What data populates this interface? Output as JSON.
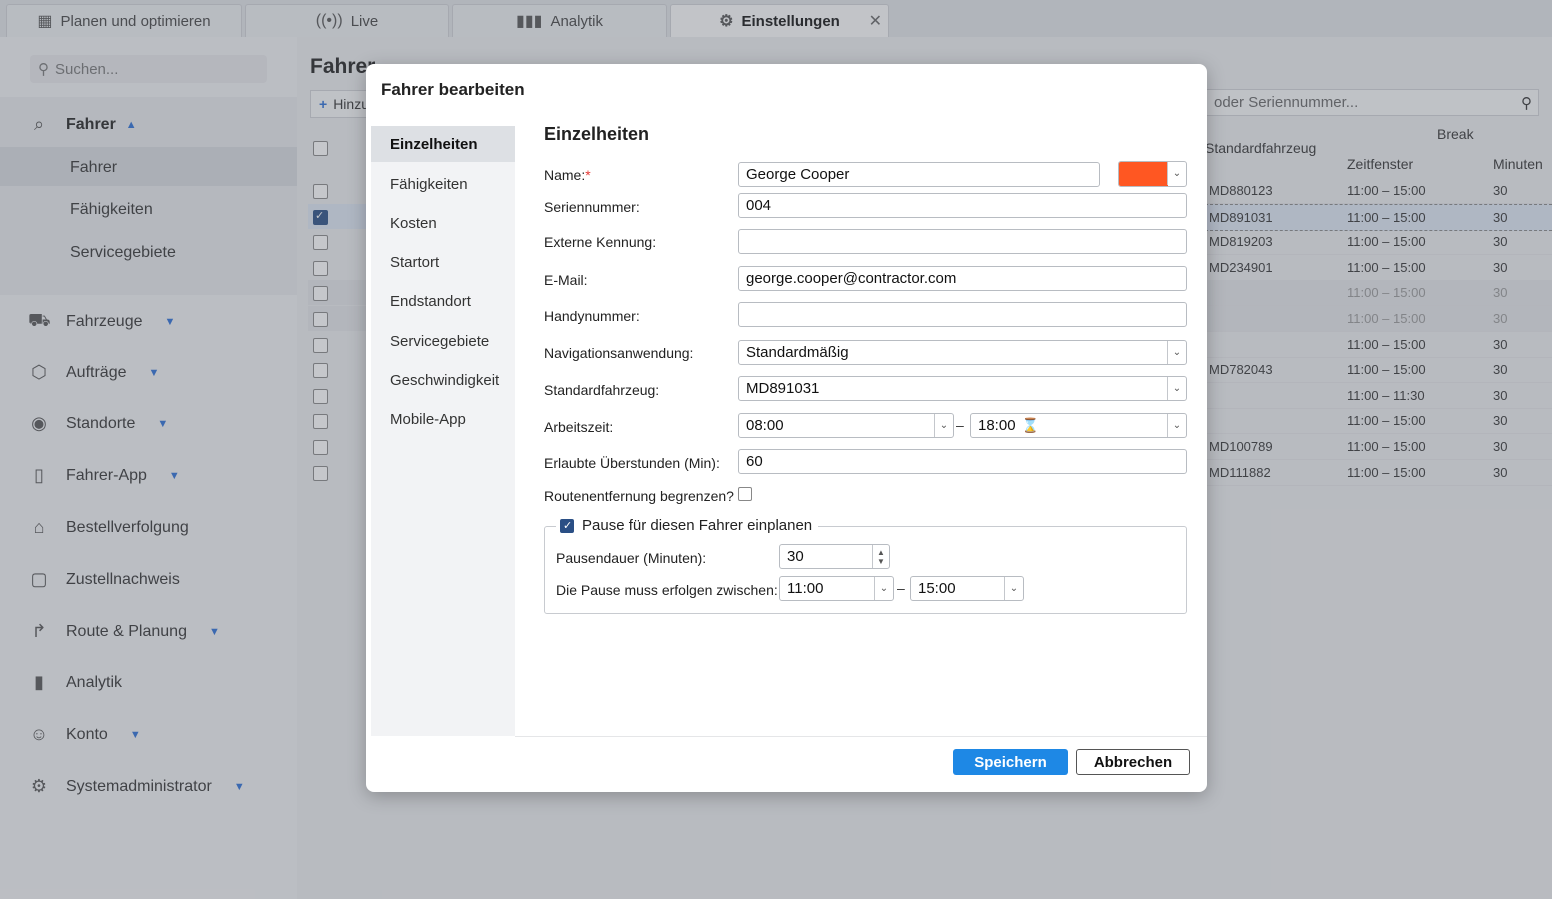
{
  "tabs": [
    {
      "label": "Planen und optimieren",
      "icon": "calendar-icon"
    },
    {
      "label": "Live",
      "icon": "broadcast-icon"
    },
    {
      "label": "Analytik",
      "icon": "bar-chart-icon"
    },
    {
      "label": "Einstellungen",
      "icon": "gear-icon",
      "active": true
    }
  ],
  "sidebar": {
    "search_placeholder": "Suchen...",
    "group": {
      "label": "Fahrer",
      "sub": [
        "Fahrer",
        "Fähigkeiten",
        "Servicegebiete"
      ]
    },
    "items": [
      {
        "label": "Fahrzeuge",
        "icon": "truck-icon",
        "has_caret": true
      },
      {
        "label": "Aufträge",
        "icon": "box-icon",
        "has_caret": true
      },
      {
        "label": "Standorte",
        "icon": "location-pin-icon",
        "has_caret": true
      },
      {
        "label": "Fahrer-App",
        "icon": "phone-icon",
        "has_caret": true
      },
      {
        "label": "Bestellverfolgung",
        "icon": "tag-icon",
        "has_caret": false
      },
      {
        "label": "Zustellnachweis",
        "icon": "clipboard-icon",
        "has_caret": false
      },
      {
        "label": "Route & Planung",
        "icon": "route-arrow-icon",
        "has_caret": true
      },
      {
        "label": "Analytik",
        "icon": "bar-chart-icon",
        "has_caret": false
      },
      {
        "label": "Konto",
        "icon": "user-icon",
        "has_caret": true
      },
      {
        "label": "Systemadministrator",
        "icon": "gear-icon",
        "has_caret": true
      }
    ]
  },
  "background": {
    "title": "Fahrer",
    "add_label": "Hinzu",
    "search_placeholder": "oder Seriennummer...",
    "headers": {
      "vehicle": "Standardfahrzeug",
      "break": "Break",
      "window": "Zeitfenster",
      "minutes": "Minuten"
    },
    "rows": [
      {
        "vehicle": "MD880123",
        "window": "11:00 – 15:00",
        "minutes": "30"
      },
      {
        "vehicle": "MD891031",
        "window": "11:00 – 15:00",
        "minutes": "30",
        "selected": true
      },
      {
        "vehicle": "MD819203",
        "window": "11:00 – 15:00",
        "minutes": "30"
      },
      {
        "vehicle": "MD234901",
        "window": "11:00 – 15:00",
        "minutes": "30"
      },
      {
        "vehicle": "",
        "window": "11:00 – 15:00",
        "minutes": "30",
        "dim": true
      },
      {
        "vehicle": "",
        "window": "11:00 – 15:00",
        "minutes": "30",
        "dim": true
      },
      {
        "vehicle": "",
        "window": "11:00 – 15:00",
        "minutes": "30"
      },
      {
        "vehicle": "MD782043",
        "window": "11:00 – 15:00",
        "minutes": "30"
      },
      {
        "vehicle": "",
        "window": "11:00 – 11:30",
        "minutes": "30"
      },
      {
        "vehicle": "",
        "window": "11:00 – 15:00",
        "minutes": "30"
      },
      {
        "vehicle": "MD100789",
        "window": "11:00 – 15:00",
        "minutes": "30"
      },
      {
        "vehicle": "MD111882",
        "window": "11:00 – 15:00",
        "minutes": "30"
      }
    ]
  },
  "modal": {
    "title": "Fahrer bearbeiten",
    "nav": [
      "Einzelheiten",
      "Fähigkeiten",
      "Kosten",
      "Startort",
      "Endstandort",
      "Servicegebiete",
      "Geschwindigkeit",
      "Mobile-App"
    ],
    "section_title": "Einzelheiten",
    "labels": {
      "name": "Name:",
      "required_mark": "*",
      "serial": "Seriennummer:",
      "external_id": "Externe Kennung:",
      "email": "E-Mail:",
      "phone": "Handynummer:",
      "nav_app": "Navigationsanwendung:",
      "default_vehicle": "Standardfahrzeug:",
      "work_time": "Arbeitszeit:",
      "overtime": "Erlaubte Überstunden (Min):",
      "limit_route": "Routenentfernung begrenzen?",
      "break_plan": "Pause für diesen Fahrer einplanen",
      "break_duration": "Pausendauer (Minuten):",
      "break_between": "Die Pause muss erfolgen zwischen:"
    },
    "values": {
      "name": "George Cooper",
      "color": "#ff5722",
      "serial": "004",
      "external_id": "",
      "email": "george.cooper@contractor.com",
      "phone": "",
      "nav_app": "Standardmäßig",
      "default_vehicle": "MD891031",
      "work_start": "08:00",
      "work_end": "18:00",
      "overtime": "60",
      "limit_route": false,
      "break_plan": true,
      "break_duration": "30",
      "break_start": "11:00",
      "break_end": "15:00"
    },
    "buttons": {
      "save": "Speichern",
      "cancel": "Abbrechen"
    }
  }
}
